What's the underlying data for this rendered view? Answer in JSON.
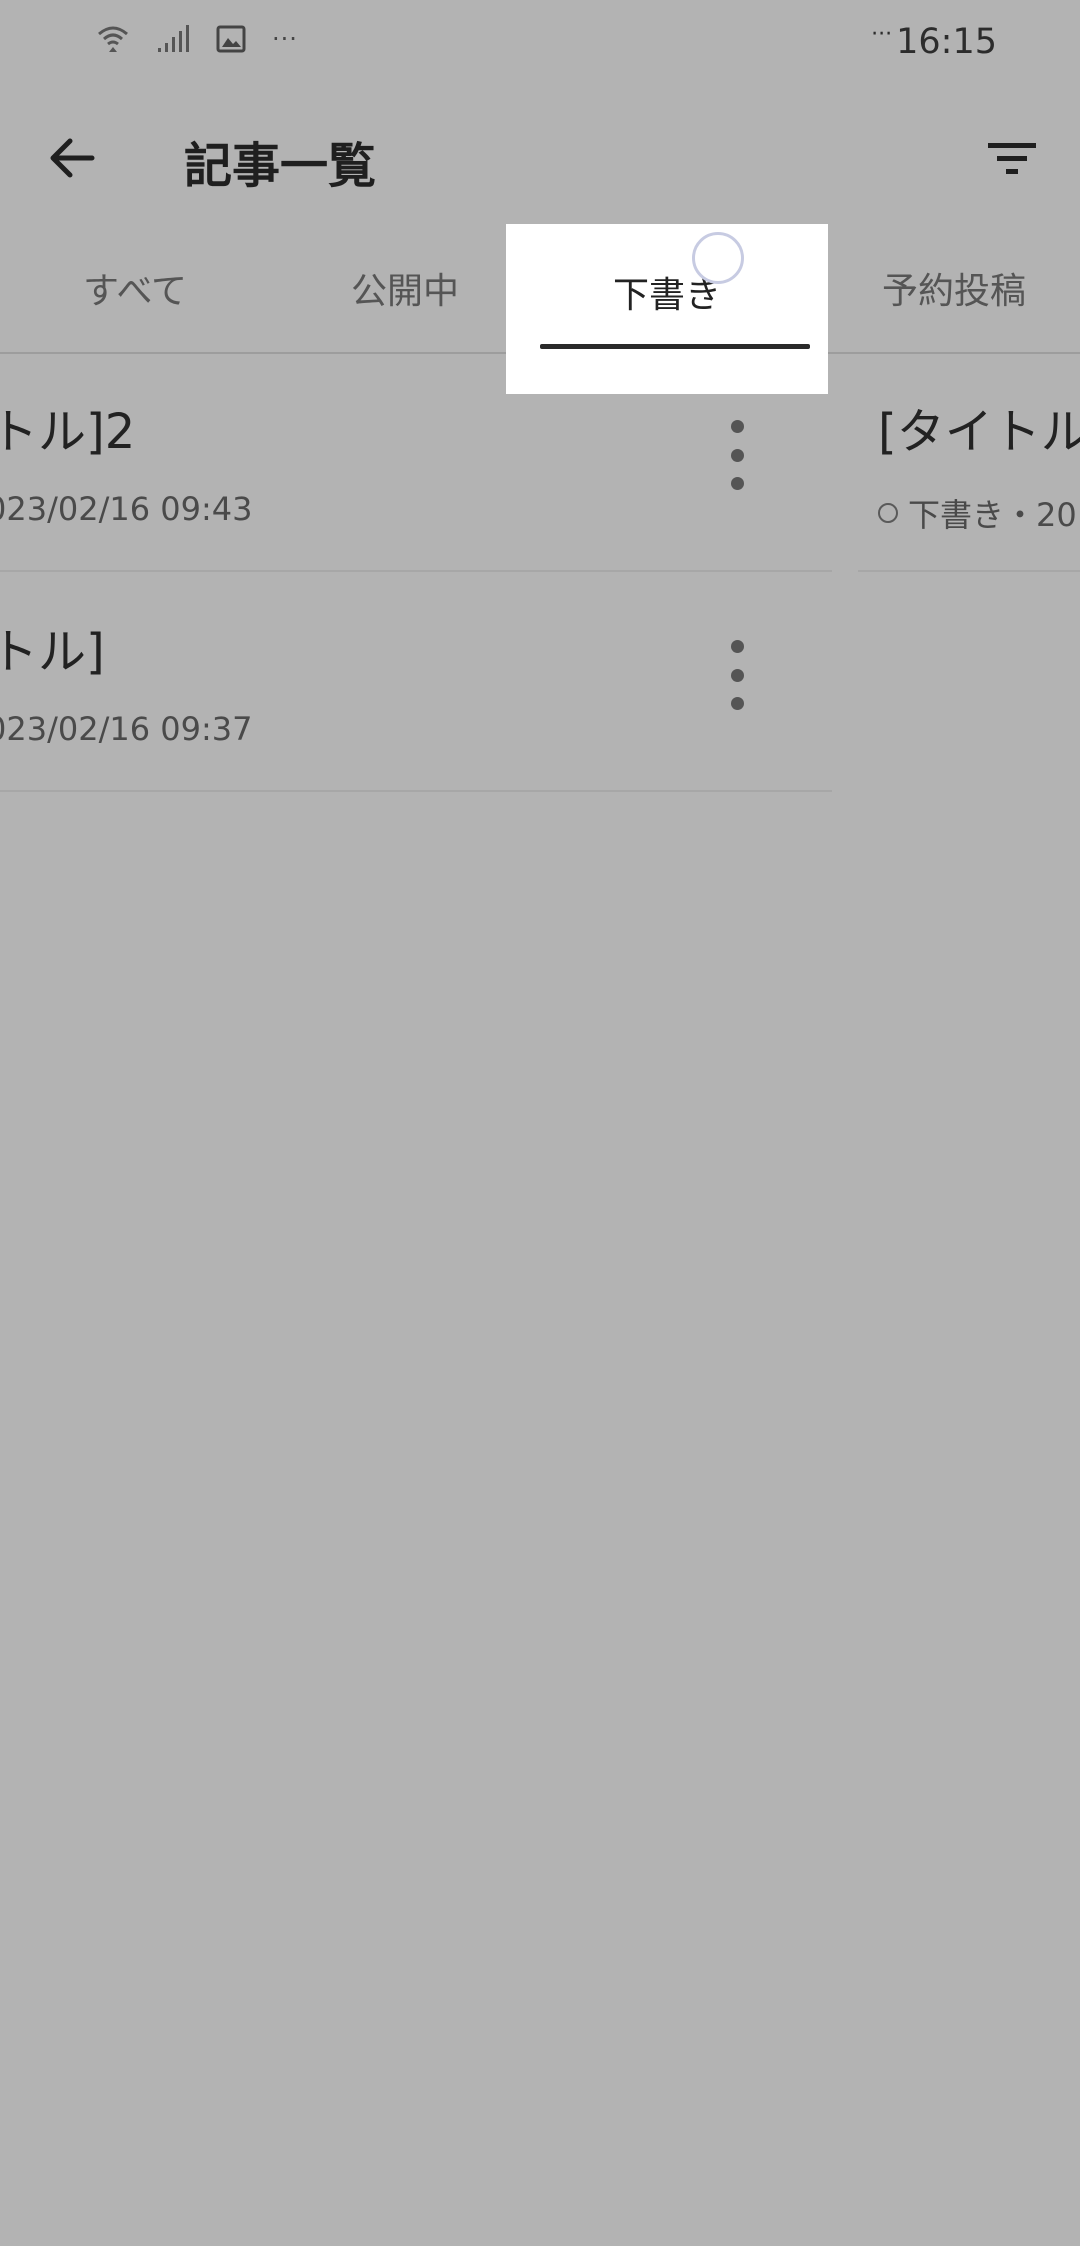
{
  "status_bar": {
    "time": "16:15",
    "time_prefix": "···",
    "overflow": "···"
  },
  "header": {
    "title": "記事一覧"
  },
  "tabs": [
    {
      "label": "すべて"
    },
    {
      "label": "公開中"
    },
    {
      "label": "下書き",
      "active": true
    },
    {
      "label": "予約投稿"
    }
  ],
  "drafts": [
    {
      "title": "トル]2",
      "meta": "023/02/16 09:43"
    },
    {
      "title": "トル]",
      "meta": "023/02/16 09:37"
    }
  ],
  "next_page": {
    "title": "[タイトル",
    "meta": "下書き・20"
  }
}
